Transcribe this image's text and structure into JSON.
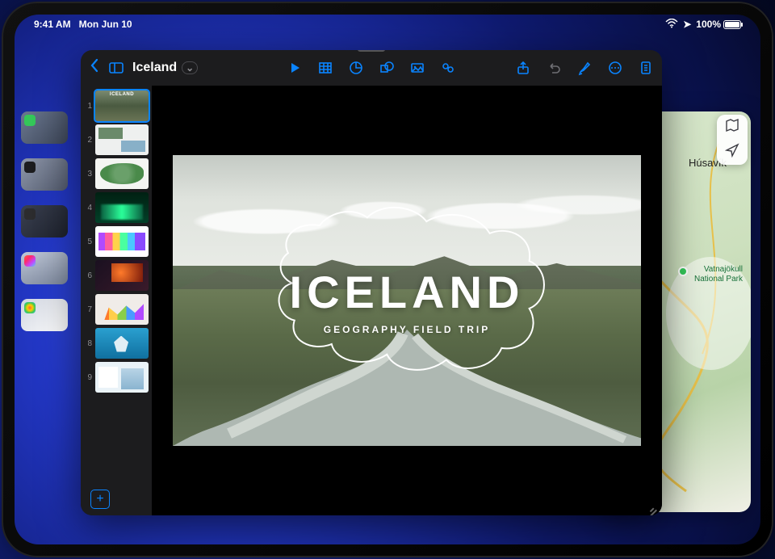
{
  "status": {
    "time": "9:41 AM",
    "date": "Mon Jun 10",
    "battery_pct": "100%"
  },
  "stage_manager": {
    "items": [
      {
        "app": "Messages"
      },
      {
        "app": "Files"
      },
      {
        "app": "Calculator"
      },
      {
        "app": "Siri Shortcuts"
      },
      {
        "app": "Photos"
      }
    ]
  },
  "maps_window": {
    "places": {
      "husavik": "Húsavík",
      "vatnajokull": "Vatnajökull\nNational Park"
    },
    "controls": {
      "mode": "map-mode",
      "locate": "locate"
    }
  },
  "keynote": {
    "document_title": "Iceland",
    "toolbar": {
      "back": "Back",
      "play": "Play",
      "table": "Table",
      "chart": "Chart",
      "shape": "Shape",
      "media": "Media",
      "comment": "Text",
      "share": "Share",
      "undo": "Undo",
      "format": "Format",
      "more": "More",
      "document": "Document"
    },
    "slides": [
      {
        "n": 1,
        "label": "ICELAND"
      },
      {
        "n": 2,
        "label": ""
      },
      {
        "n": 3,
        "label": ""
      },
      {
        "n": 4,
        "label": ""
      },
      {
        "n": 5,
        "label": ""
      },
      {
        "n": 6,
        "label": ""
      },
      {
        "n": 7,
        "label": ""
      },
      {
        "n": 8,
        "label": ""
      },
      {
        "n": 9,
        "label": ""
      }
    ],
    "selected_slide": 1,
    "add_slide_label": "+",
    "current_slide": {
      "title": "ICELAND",
      "subtitle": "GEOGRAPHY FIELD TRIP"
    }
  }
}
